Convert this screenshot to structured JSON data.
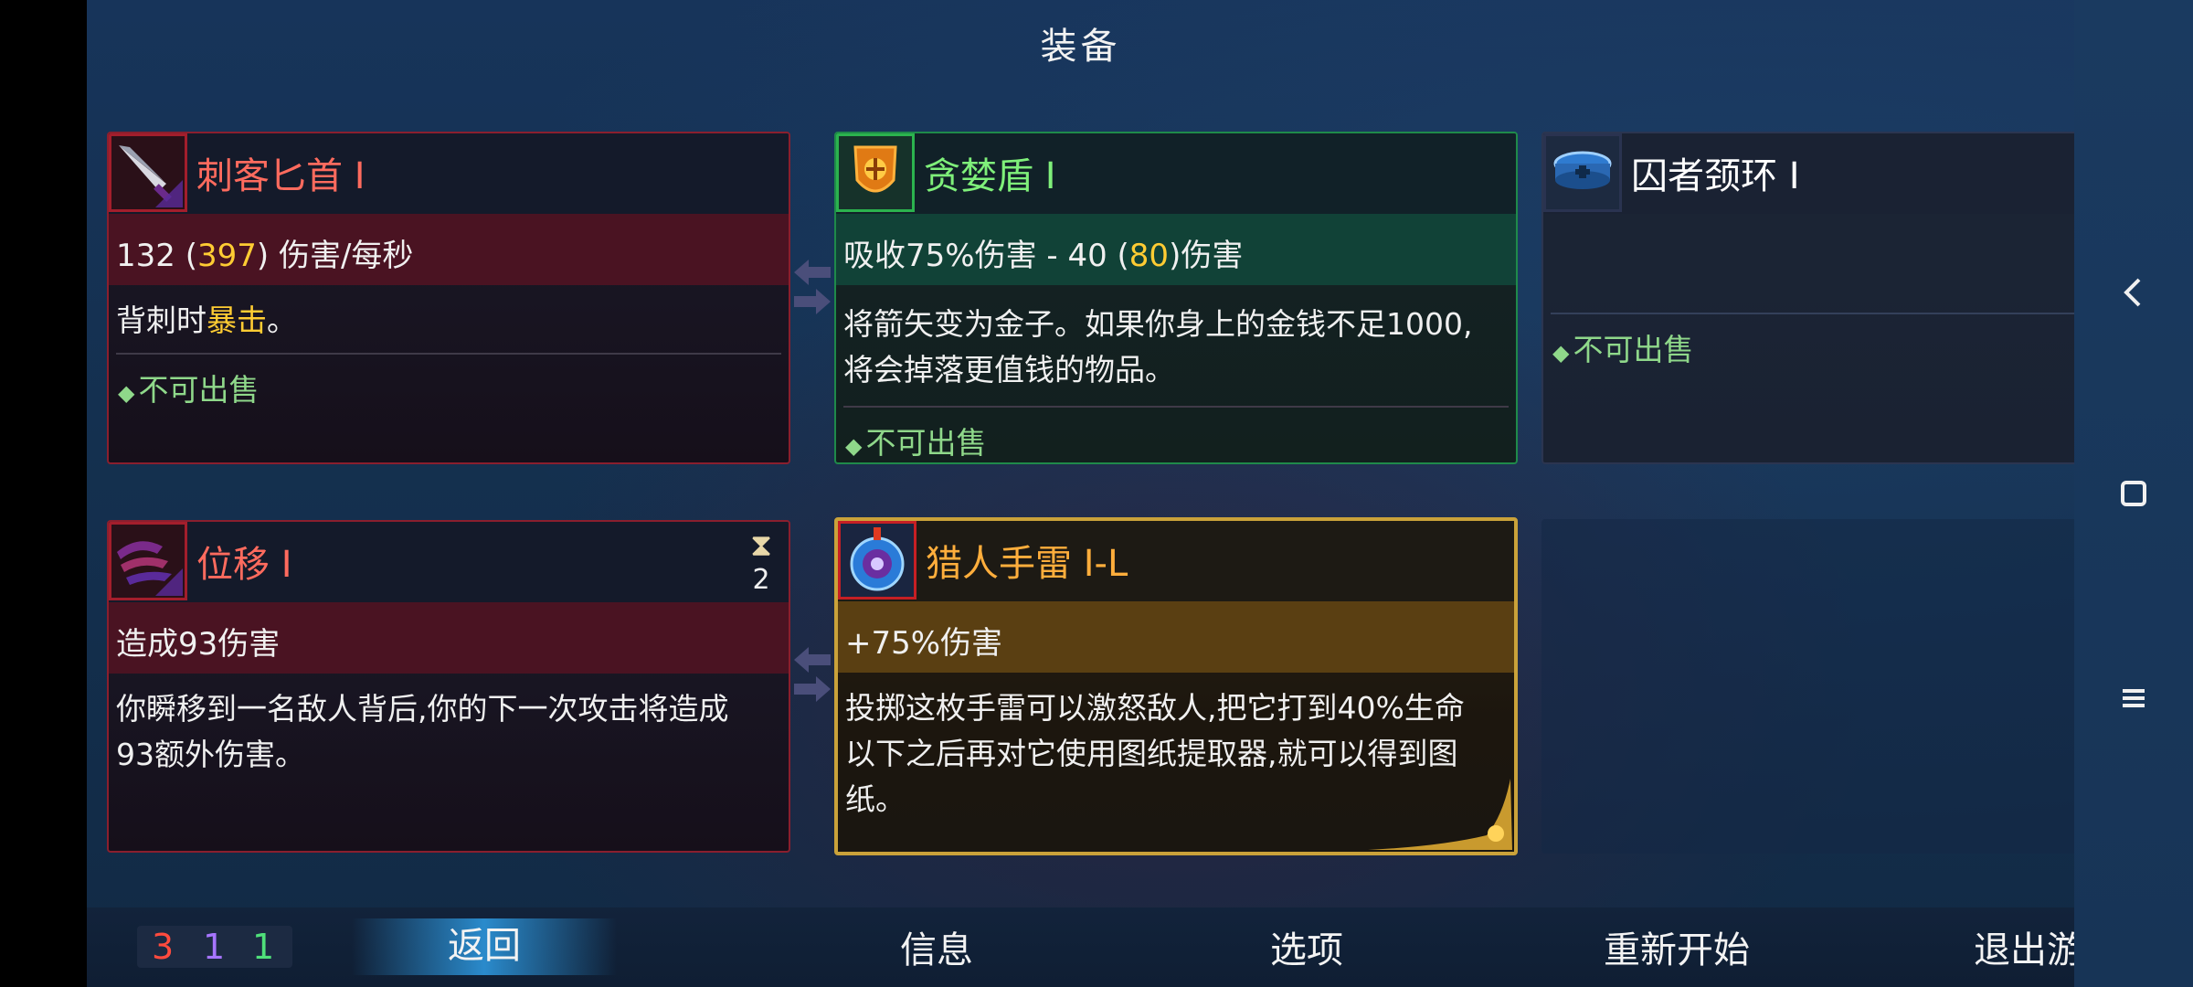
{
  "title": "装备",
  "cards": {
    "dagger": {
      "name": "刺客匕首 I",
      "stat_base": "132 (",
      "stat_gold": "397",
      "stat_tail": ") 伤害/每秒",
      "desc_pre": "背刺时",
      "desc_gold": "暴击",
      "desc_post": "。",
      "unsellable": "不可出售"
    },
    "shield": {
      "name": "贪婪盾 I",
      "stat_base": "吸收75%伤害 - 40 (",
      "stat_gold": "80",
      "stat_tail": ")伤害",
      "desc_line1": "将箭矢变为金子。如果你身上的金钱不足1000,",
      "desc_line2": "将会掉落更值钱的物品。",
      "unsellable": "不可出售"
    },
    "collar": {
      "name": "囚者颈环 I",
      "unsellable": "不可出售"
    },
    "blink": {
      "name": "位移 I",
      "cooldown": "2",
      "stat": "造成93伤害",
      "desc_line1": "你瞬移到一名敌人背后,你的下一次攻击将造成",
      "desc_line2": "93额外伤害。"
    },
    "grenade": {
      "name": "猎人手雷 I-L",
      "stat": "+75%伤害",
      "desc_line1": "投掷这枚手雷可以激怒敌人,把它打到40%生命",
      "desc_line2": "以下之后再对它使用图纸提取器,就可以得到图",
      "desc_line3": "纸。"
    }
  },
  "counters": {
    "red": "3",
    "purple": "1",
    "green": "1"
  },
  "menu": {
    "back": "返回",
    "info": "信息",
    "options": "选项",
    "restart": "重新开始",
    "quit": "退出游戏"
  },
  "system_nav": {
    "back_icon": "chevron-left",
    "home_icon": "square",
    "menu_icon": "hamburger"
  }
}
